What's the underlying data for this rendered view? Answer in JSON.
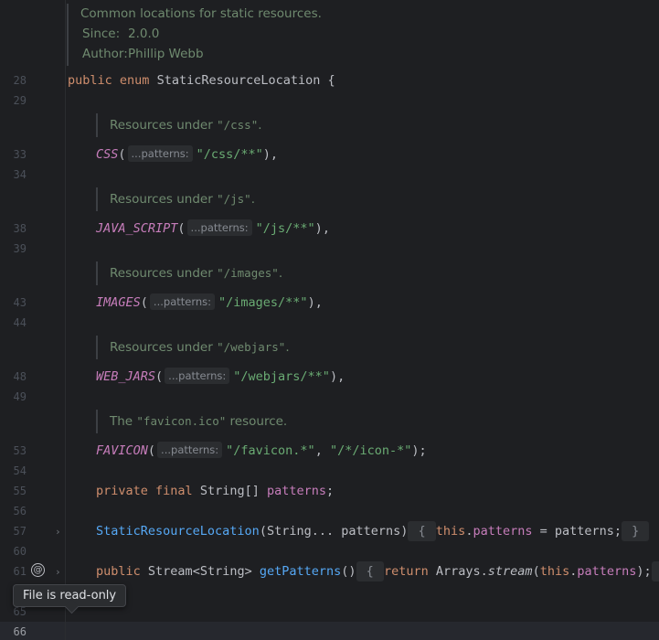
{
  "doc": {
    "summary": "Common locations for static resources.",
    "since_label": "Since:",
    "since_value": "2.0.0",
    "author_label": "Author:",
    "author_value": "Phillip Webb"
  },
  "lines": [
    "28",
    "29",
    "33",
    "34",
    "38",
    "39",
    "43",
    "44",
    "48",
    "49",
    "53",
    "54",
    "55",
    "56",
    "57",
    "60",
    "61",
    "65",
    "66"
  ],
  "enum_decl": {
    "public": "public",
    "enum": "enum",
    "name": "StaticResourceLocation {"
  },
  "hint": "...patterns:",
  "constants": [
    {
      "doc_pre": "Resources under ",
      "doc_code": "\"/css\"",
      "doc_post": ".",
      "name": "CSS",
      "args": "\"/css/**\"",
      "tail": ","
    },
    {
      "doc_pre": "Resources under ",
      "doc_code": "\"/js\"",
      "doc_post": ".",
      "name": "JAVA_SCRIPT",
      "args": "\"/js/**\"",
      "tail": ","
    },
    {
      "doc_pre": "Resources under ",
      "doc_code": "\"/images\"",
      "doc_post": ".",
      "name": "IMAGES",
      "args": "\"/images/**\"",
      "tail": ","
    },
    {
      "doc_pre": "Resources under ",
      "doc_code": "\"/webjars\"",
      "doc_post": ".",
      "name": "WEB_JARS",
      "args": "\"/webjars/**\"",
      "tail": ","
    }
  ],
  "favicon": {
    "doc_pre": "The ",
    "doc_code": "\"favicon.ico\"",
    "doc_post": " resource.",
    "name": "FAVICON",
    "arg1": "\"/favicon.*\"",
    "comma": ", ",
    "arg2": "\"/*/icon-*\"",
    "tail": ");"
  },
  "field": {
    "private": "private",
    "final": "final",
    "type": "String[]",
    "name": "patterns",
    "semi": ";"
  },
  "ctor": {
    "name": "StaticResourceLocation",
    "params": "(String... patterns)",
    "fold_open": "{",
    "this": "this",
    "field": "patterns",
    "rest": " = patterns;",
    "fold_close": "}"
  },
  "getter": {
    "public": "public",
    "type": "Stream<String>",
    "name": "getPatterns",
    "parens": "()",
    "fold_open": "{",
    "ret": "return",
    "cls": "Arrays.",
    "call": "stream",
    "this": "this",
    "field": "patterns",
    "rest": ");",
    "fold_close": "}"
  },
  "tooltip": "File is read-only",
  "at_symbol": "@",
  "fold_arrow": "›"
}
